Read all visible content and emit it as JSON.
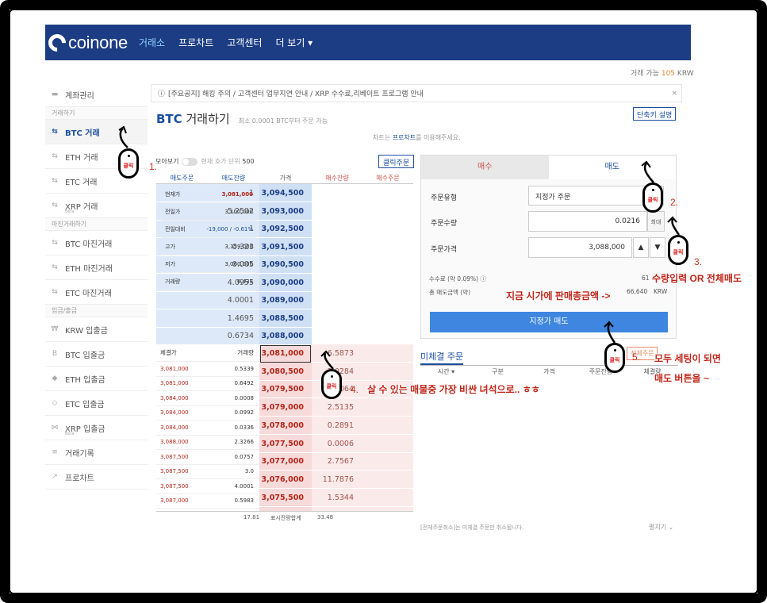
{
  "header": {
    "logo_text": "coinone",
    "nav": [
      "거래소",
      "프로차트",
      "고객센터",
      "더 보기 ▾"
    ]
  },
  "balance": {
    "label": "거래 가능",
    "value": "105",
    "unit": "KRW"
  },
  "sidebar": {
    "items": [
      {
        "type": "item",
        "icon": "folder-icon",
        "label": "계좌관리"
      },
      {
        "type": "cat",
        "label": "거래하기"
      },
      {
        "type": "item",
        "icon": "swap-icon",
        "label": "BTC 거래",
        "selected": true
      },
      {
        "type": "item",
        "icon": "swap-icon",
        "label": "ETH 거래"
      },
      {
        "type": "item",
        "icon": "swap-icon",
        "label": "ETC 거래"
      },
      {
        "type": "item",
        "icon": "swap-icon",
        "label": "XRP 거래",
        "sub": "Beta"
      },
      {
        "type": "cat",
        "label": "마진거래하기"
      },
      {
        "type": "item",
        "icon": "swap-icon",
        "label": "BTC 마진거래"
      },
      {
        "type": "item",
        "icon": "swap-icon",
        "label": "ETH 마진거래"
      },
      {
        "type": "item",
        "icon": "swap-icon",
        "label": "ETC 마진거래"
      },
      {
        "type": "cat",
        "label": "입금/출금"
      },
      {
        "type": "item",
        "icon": "won-icon",
        "label": "KRW 입출금"
      },
      {
        "type": "item",
        "icon": "bitcoin-icon",
        "label": "BTC 입출금"
      },
      {
        "type": "item",
        "icon": "ethereum-icon",
        "label": "ETH 입출금"
      },
      {
        "type": "item",
        "icon": "etc-icon",
        "label": "ETC 입출금"
      },
      {
        "type": "item",
        "icon": "xrp-icon",
        "label": "XRP 입출금",
        "sub": "Beta"
      },
      {
        "type": "item",
        "icon": "list-icon",
        "label": "거래기록"
      },
      {
        "type": "item",
        "icon": "chart-icon",
        "label": "프로차트"
      }
    ]
  },
  "notice": {
    "icon": "info-icon",
    "text": "[주요공지] 해킹 주의 / 고객센터 업무지연 안내 / XRP 수수료,리베이트 프로그램 안내"
  },
  "page_title": {
    "coin": "BTC",
    "text": "거래하기",
    "note": "최소 0.0001 BTC부터 주문 가능"
  },
  "shortcut_button": "단축키 설명",
  "chart_message": {
    "pre": "차트는 ",
    "link": "프로차트",
    "post": "를 이용해주세요."
  },
  "group_view": {
    "label": "모아보기",
    "note": "현재 호가 단위",
    "value": "500"
  },
  "click_order_button": "클릭주문",
  "orderbook": {
    "headers": [
      "매도주문",
      "매도잔량",
      "가격",
      "매수잔량",
      "매수주문"
    ],
    "asks": [
      {
        "qty": "1",
        "price": "3,094,500"
      },
      {
        "qty": "5.2502",
        "price": "3,093,000"
      },
      {
        "qty": "1",
        "price": "3,092,500"
      },
      {
        "qty": "0.323",
        "price": "3,091,500"
      },
      {
        "qty": "0.005",
        "price": "3,090,500"
      },
      {
        "qty": "4.0955",
        "price": "3,090,000"
      },
      {
        "qty": "4.0001",
        "price": "3,089,000"
      },
      {
        "qty": "1.4695",
        "price": "3,088,500"
      },
      {
        "qty": "0.6734",
        "price": "3,088,000"
      }
    ],
    "bids": [
      {
        "price": "3,081,000",
        "qty": "6.5873"
      },
      {
        "price": "3,080,500",
        "qty": "2.0284"
      },
      {
        "price": "3,079,500",
        "qty": "1.0064"
      },
      {
        "price": "3,079,000",
        "qty": "2.5135"
      },
      {
        "price": "3,078,000",
        "qty": "0.2891"
      },
      {
        "price": "3,077,500",
        "qty": "0.0006"
      },
      {
        "price": "3,077,000",
        "qty": "2.7567"
      },
      {
        "price": "3,076,000",
        "qty": "11.7876"
      },
      {
        "price": "3,075,500",
        "qty": "1.5344"
      }
    ],
    "info": [
      {
        "k": "현재가",
        "v": "3,081,000"
      },
      {
        "k": "전일가",
        "v": "3,100,000"
      },
      {
        "k": "전일대비",
        "v": "-19,000 / -0.61%"
      },
      {
        "k": "고가",
        "v": "3,159,000"
      },
      {
        "k": "저가",
        "v": "3,060,000"
      },
      {
        "k": "거래량",
        "v": "6,433"
      }
    ],
    "trades_header": [
      "체결가",
      "거래량"
    ],
    "trades": [
      {
        "p": "3,081,000",
        "q": "0.5339"
      },
      {
        "p": "3,081,000",
        "q": "0.6492"
      },
      {
        "p": "3,084,000",
        "q": "0.0008"
      },
      {
        "p": "3,084,000",
        "q": "0.0992"
      },
      {
        "p": "3,084,000",
        "q": "0.0336"
      },
      {
        "p": "3,088,000",
        "q": "2.3266"
      },
      {
        "p": "3,087,500",
        "q": "0.0757"
      },
      {
        "p": "3,087,500",
        "q": "3.0"
      },
      {
        "p": "3,087,500",
        "q": "4.0001"
      },
      {
        "p": "3,087,000",
        "q": "0.5983"
      }
    ],
    "footer": {
      "ask_total": "17.81",
      "label": "표시잔량합계",
      "bid_total": "33.48"
    }
  },
  "order_form": {
    "tabs": [
      "매수",
      "매도"
    ],
    "type_label": "주문유형",
    "type_value": "지정가 주문",
    "qty_label": "주문수량",
    "qty_value": "0.0216",
    "max_label": "최대",
    "price_label": "주문가격",
    "price_value": "3,088,000",
    "fee_label": "수수료 (약 0.09%)",
    "fee_value": "61",
    "total_label": "총 매도금액 (약)",
    "total_value": "66,640",
    "total_unit": "KRW",
    "submit": "지정가 매도"
  },
  "unfilled": {
    "title": "미체결 주문",
    "cancel_all": "전체주문",
    "headers": [
      "시간 ▾",
      "구분",
      "가격",
      "주문잔량",
      "체결량"
    ],
    "footer": "[전체주문취소]는 미체결 주문만 취소됩니다.",
    "more": "펼치기"
  },
  "annotations": {
    "mouse_text": "클릭",
    "n1": "1.",
    "n2": "2.",
    "n3": "3.",
    "n4": "4.",
    "n5": "5.",
    "c3": "수량입력 OR 전체매도",
    "c_total": "지금 시가에 판매총금액 ->",
    "c4": "살 수 있는 매물중 가장 비싼 녀석으로.. ㅎㅎ",
    "c5a": "모두 세팅이 되면",
    "c5b": "매도 버튼을 ~"
  }
}
